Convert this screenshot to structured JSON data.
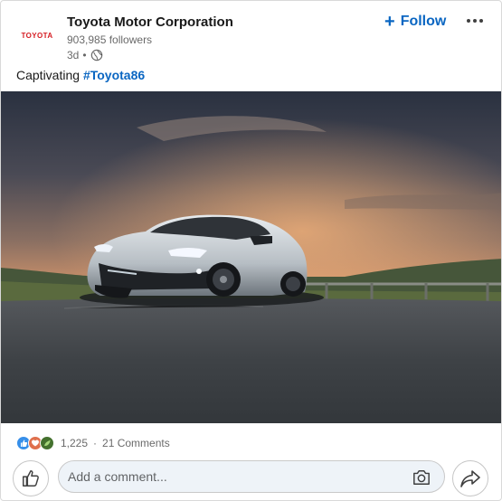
{
  "post": {
    "company_name": "Toyota Motor Corporation",
    "logo_text": "TOYOTA",
    "followers": "903,985 followers",
    "time_ago": "3d",
    "time_separator": "•",
    "follow_label": "Follow",
    "caption_text": "Captivating ",
    "hashtag": "#Toyota86"
  },
  "social": {
    "reaction_count": "1,225",
    "separator": "·",
    "comments": "21 Comments"
  },
  "comment": {
    "placeholder": "Add a comment..."
  },
  "icons": {
    "globe": "globe-icon",
    "follow": "plus-icon",
    "more": "more-dots-icon",
    "like": "thumbs-up-icon",
    "camera": "camera-icon",
    "share": "share-arrow-icon"
  },
  "colors": {
    "accent": "#0a66c2",
    "logo": "#d51c22",
    "reaction_like": "#378fe9",
    "reaction_love": "#df704d",
    "reaction_insightful": "#44712e"
  }
}
